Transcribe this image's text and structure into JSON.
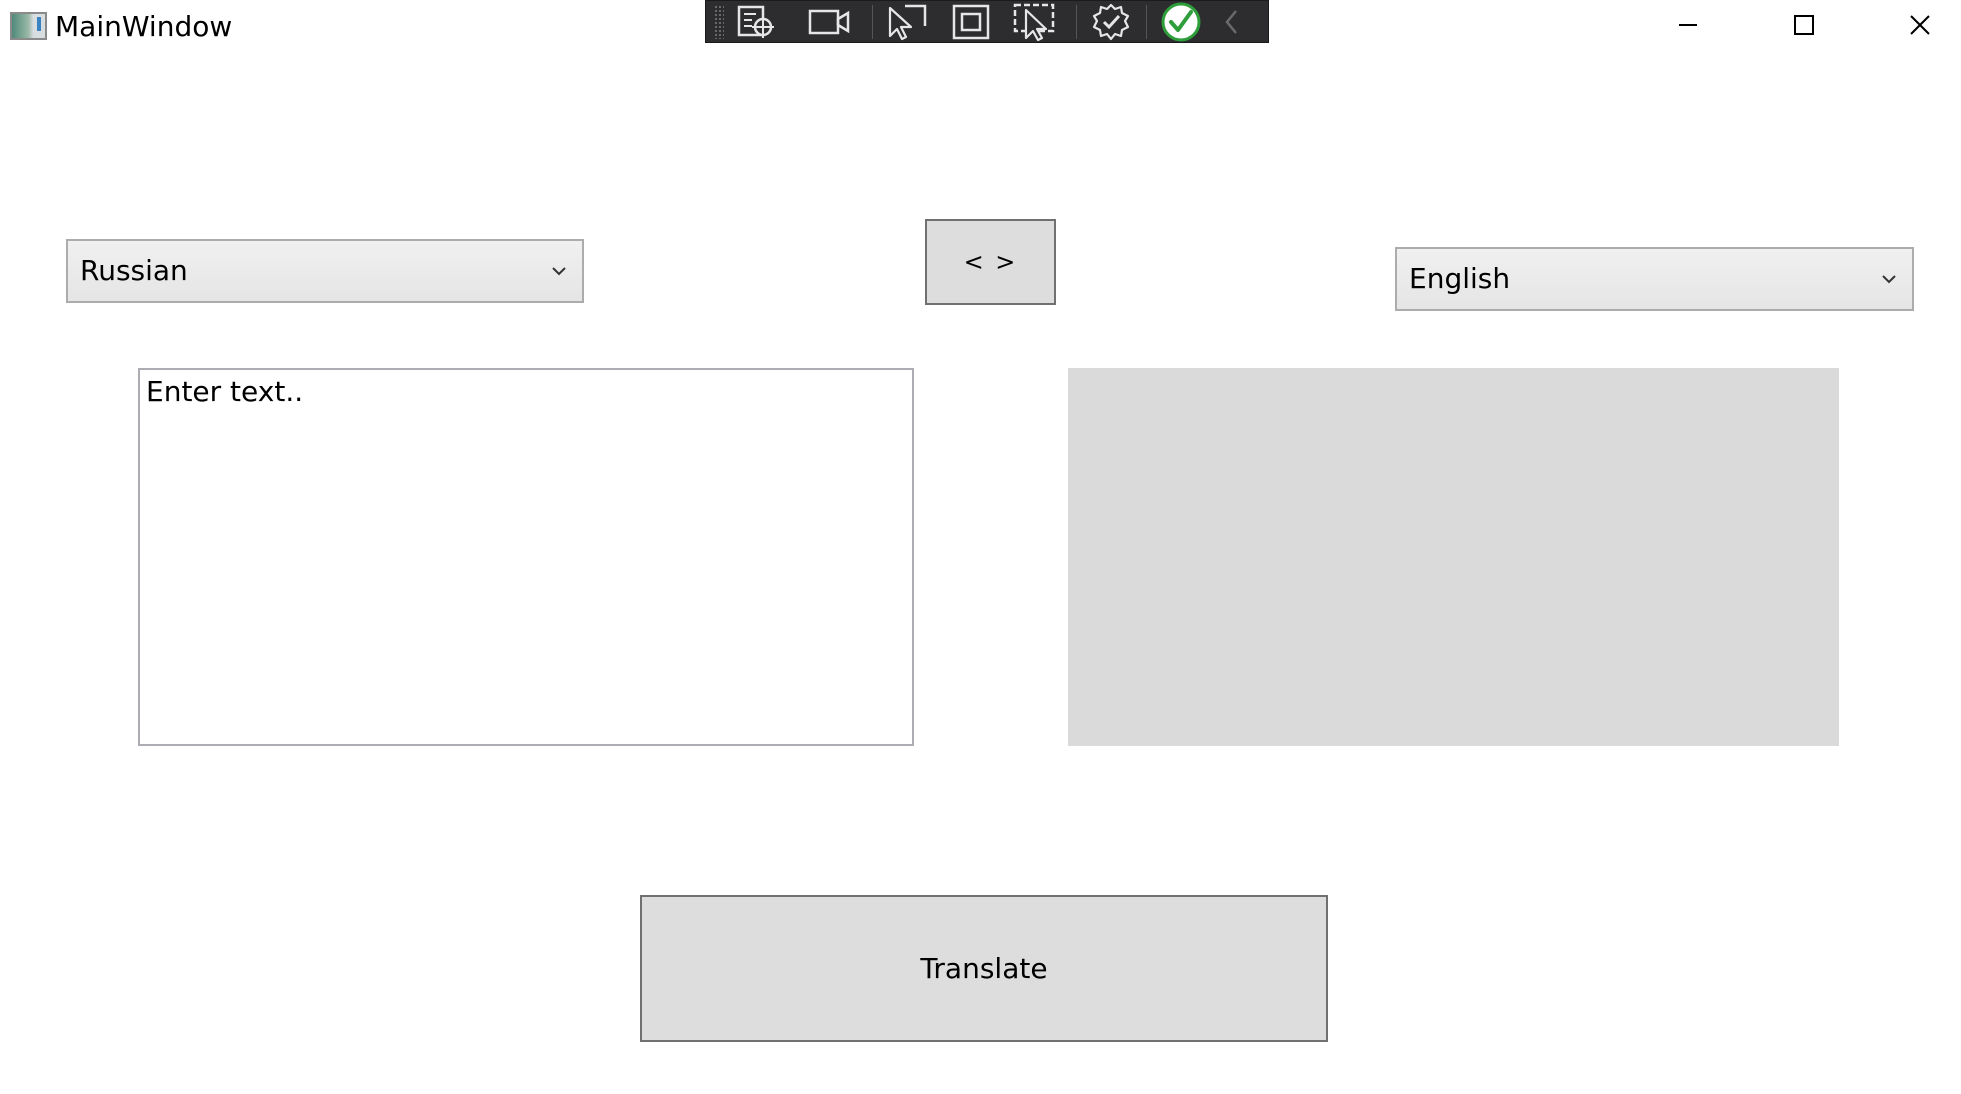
{
  "window": {
    "title": "MainWindow"
  },
  "debug_toolbar": {
    "icons": [
      "live-visual-tree-icon",
      "record-icon",
      "select-element-icon",
      "display-layout-adorners-icon",
      "track-focus-icon",
      "hot-reload-icon",
      "check-icon",
      "collapse-icon"
    ]
  },
  "source_language": {
    "selected": "Russian"
  },
  "target_language": {
    "selected": "English"
  },
  "swap_button": {
    "label": "< >"
  },
  "input": {
    "value": "Enter text.."
  },
  "output": {
    "value": ""
  },
  "translate_button": {
    "label": "Translate"
  },
  "colors": {
    "button_bg": "#dddddd",
    "output_bg": "#dadada",
    "toolbar_bg": "#2d2d30",
    "check_green": "#2e9e3a"
  }
}
